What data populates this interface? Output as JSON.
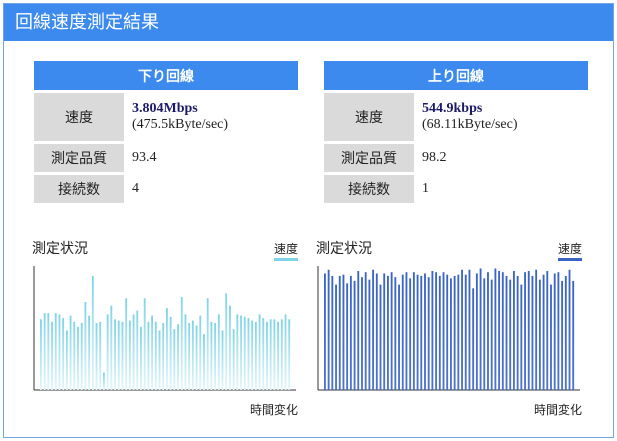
{
  "header": {
    "title": "回線速度測定結果"
  },
  "download": {
    "heading": "下り回線",
    "speed_label": "速度",
    "speed_value": "3.804Mbps",
    "speed_sub": "(475.5kByte/sec)",
    "quality_label": "測定品質",
    "quality_value": "93.4",
    "connections_label": "接続数",
    "connections_value": "4"
  },
  "upload": {
    "heading": "上り回線",
    "speed_label": "速度",
    "speed_value": "544.9kbps",
    "speed_sub": "(68.11kByte/sec)",
    "quality_label": "測定品質",
    "quality_value": "98.2",
    "connections_label": "接続数",
    "connections_value": "1"
  },
  "chart_data": [
    {
      "type": "bar",
      "title": "測定状況",
      "xlabel": "時間変化",
      "ylabel": "",
      "legend": [
        "速度"
      ],
      "legend_placement": "top-right",
      "color": "#7fd3e6",
      "values": [
        0.57,
        0.62,
        0.62,
        0.55,
        0.62,
        0.61,
        0.58,
        0.48,
        0.6,
        0.55,
        0.51,
        0.54,
        0.71,
        0.6,
        0.92,
        0.54,
        0.55,
        0.14,
        0.61,
        0.68,
        0.57,
        0.56,
        0.55,
        0.74,
        0.56,
        0.61,
        0.64,
        0.51,
        0.74,
        0.55,
        0.6,
        0.55,
        0.48,
        0.54,
        0.66,
        0.59,
        0.49,
        0.53,
        0.75,
        0.61,
        0.54,
        0.56,
        0.52,
        0.6,
        0.45,
        0.74,
        0.55,
        0.54,
        0.61,
        0.48,
        0.78,
        0.68,
        0.49,
        0.61,
        0.6,
        0.59,
        0.58,
        0.56,
        0.55,
        0.61,
        0.58,
        0.55,
        0.57,
        0.57,
        0.55,
        0.57,
        0.61,
        0.57
      ]
    },
    {
      "type": "bar",
      "title": "測定状況",
      "xlabel": "時間変化",
      "ylabel": "",
      "legend": [
        "速度"
      ],
      "legend_placement": "top-right",
      "color": "#3a64c4",
      "values": [
        0.94,
        0.97,
        0.92,
        0.85,
        0.92,
        0.93,
        0.86,
        0.92,
        0.88,
        0.96,
        0.91,
        0.95,
        0.89,
        0.97,
        0.94,
        0.85,
        0.94,
        0.92,
        0.95,
        0.91,
        0.85,
        0.93,
        0.95,
        0.9,
        0.95,
        0.93,
        0.92,
        0.94,
        0.91,
        0.96,
        0.95,
        0.92,
        0.95,
        0.93,
        0.9,
        0.92,
        0.93,
        0.97,
        0.93,
        0.97,
        0.82,
        0.94,
        0.98,
        0.9,
        0.95,
        0.89,
        0.98,
        0.96,
        0.95,
        0.92,
        0.89,
        0.96,
        0.92,
        0.85,
        0.95,
        0.96,
        0.92,
        0.97,
        0.89,
        0.93,
        0.96,
        0.85,
        0.94,
        0.95,
        0.88,
        0.92,
        0.97,
        0.88
      ]
    }
  ]
}
